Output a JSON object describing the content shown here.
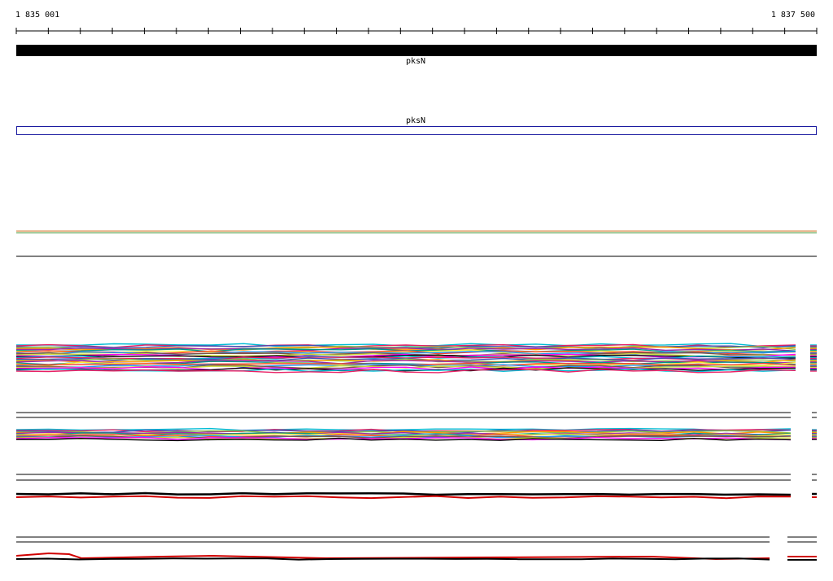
{
  "ruler": {
    "start_label": "1 835 001",
    "end_label": "1 837 500"
  },
  "tracks": {
    "gene_track": {
      "label": "pksN",
      "color": "#000000"
    },
    "transcript_track": {
      "label": "pksN",
      "color": "#1a1aa0"
    }
  },
  "colors": {
    "alignment_palette": [
      "#00bcd4",
      "#e91e63",
      "#3f51b5",
      "#8bc34a",
      "#ff9800",
      "#9c27b0",
      "#009688",
      "#ffeb3b",
      "#f44336",
      "#2196f3",
      "#795548",
      "#cddc39",
      "#ff00ff",
      "#000000"
    ],
    "highlight": "#d00000"
  }
}
